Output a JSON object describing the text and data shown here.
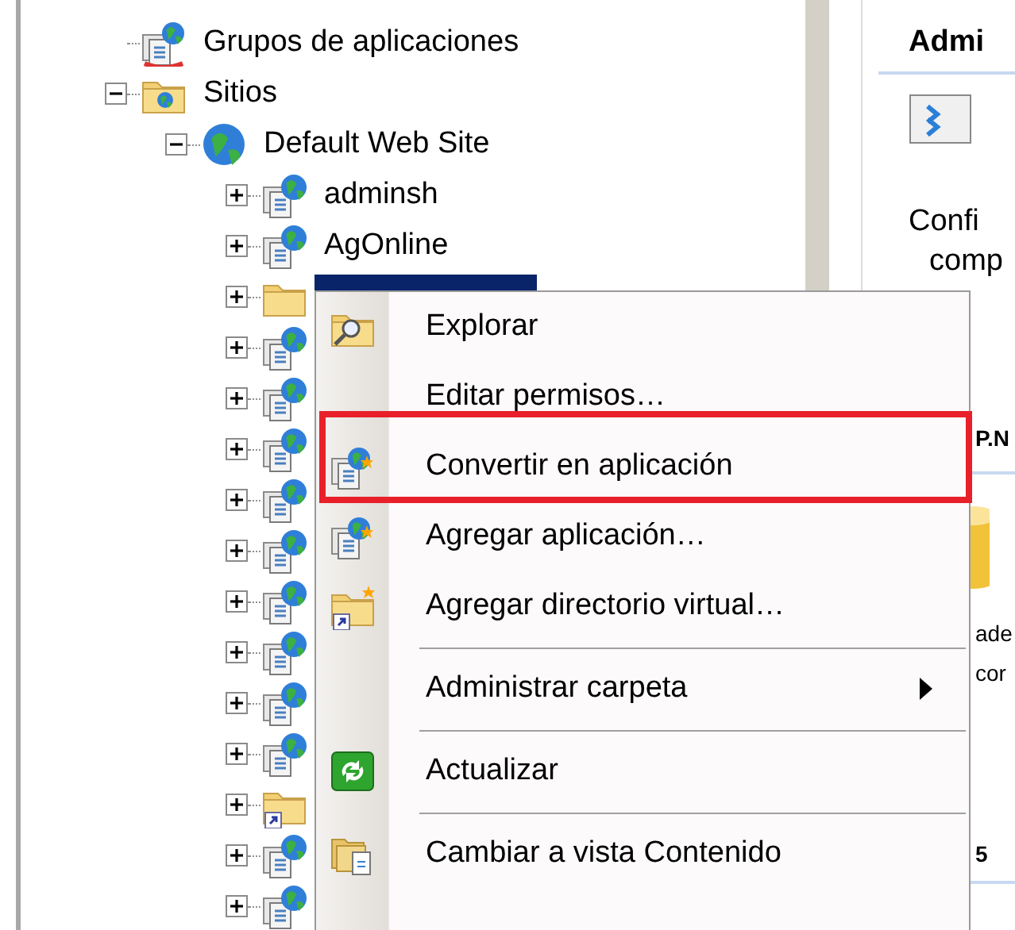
{
  "tree": [
    {
      "label": "Grupos de aplicaciones",
      "kind": "app_pools",
      "selected": false
    },
    {
      "label": "Sitios",
      "kind": "sites",
      "expanded": true,
      "selected": false,
      "children": [
        {
          "label": "Default Web Site",
          "kind": "site",
          "expanded": true,
          "selected": false,
          "children": [
            {
              "label": "adminsh",
              "kind": "application",
              "expanded": false,
              "selected": false
            },
            {
              "label": "AgOnline",
              "kind": "application",
              "expanded": false,
              "selected": false
            },
            {
              "kind": "folder",
              "expanded": false,
              "selected": true
            },
            {
              "kind": "application",
              "expanded": false,
              "selected": false
            },
            {
              "kind": "application",
              "expanded": false,
              "selected": false
            },
            {
              "kind": "application",
              "expanded": false,
              "selected": false
            },
            {
              "kind": "application",
              "expanded": false,
              "selected": false
            },
            {
              "kind": "application",
              "expanded": false,
              "selected": false
            },
            {
              "kind": "application",
              "expanded": false,
              "selected": false
            },
            {
              "kind": "application",
              "expanded": false,
              "selected": false
            },
            {
              "kind": "application",
              "expanded": false,
              "selected": false
            },
            {
              "kind": "application",
              "expanded": false,
              "selected": false
            },
            {
              "kind": "virtual_directory",
              "expanded": false,
              "selected": false
            },
            {
              "kind": "application",
              "expanded": false,
              "selected": false
            },
            {
              "kind": "application",
              "expanded": false,
              "selected": false
            }
          ]
        }
      ]
    }
  ],
  "actions_panel": {
    "title": "Admi",
    "feature_lines": [
      "Confi",
      "comp"
    ],
    "section_title": "P.N",
    "section_lines": [
      "ade",
      "cor"
    ],
    "footer": "5"
  },
  "context_menu": [
    {
      "kind": "item",
      "label": "Explorar",
      "highlighted": false
    },
    {
      "kind": "item",
      "label": "Editar permisos…",
      "highlighted": false
    },
    {
      "kind": "item",
      "label": "Convertir en aplicación",
      "highlighted": true
    },
    {
      "kind": "item",
      "label": "Agregar aplicación…",
      "highlighted": false
    },
    {
      "kind": "item",
      "label": "Agregar directorio virtual…",
      "highlighted": false
    },
    {
      "kind": "separator"
    },
    {
      "kind": "item",
      "label": "Administrar carpeta",
      "submenu": true,
      "highlighted": false
    },
    {
      "kind": "separator"
    },
    {
      "kind": "item",
      "label": "Actualizar",
      "highlighted": false
    },
    {
      "kind": "separator"
    },
    {
      "kind": "item",
      "label": "Cambiar a vista Contenido",
      "highlighted": false
    }
  ]
}
